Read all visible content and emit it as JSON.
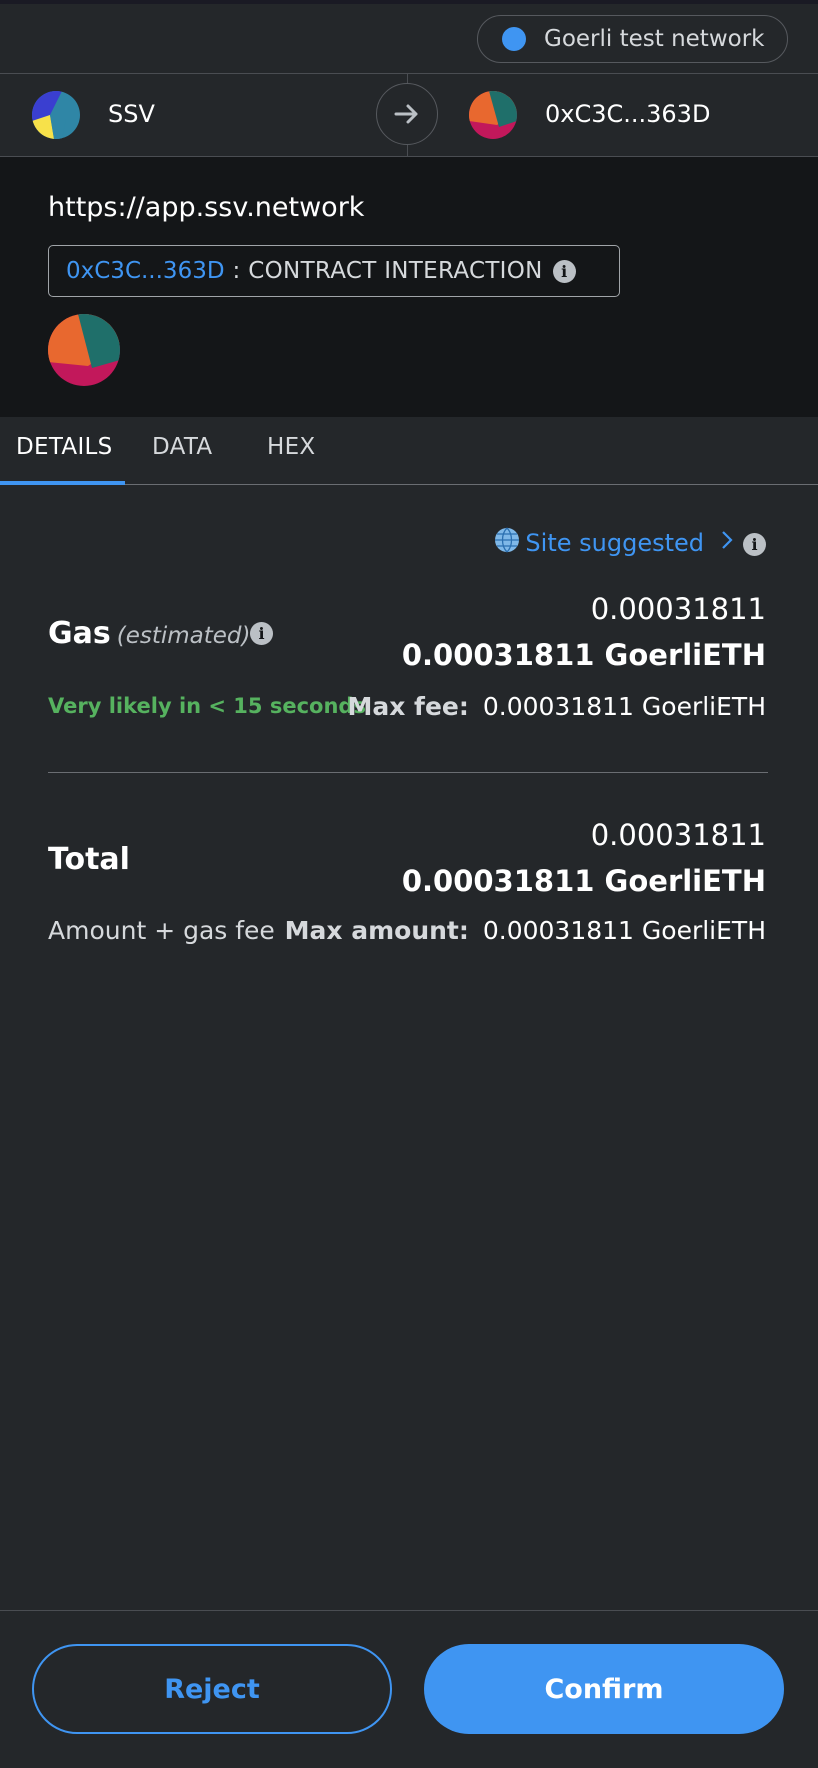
{
  "network": {
    "label": "Goerli test network",
    "dot_color": "#3f95f2"
  },
  "from_account": {
    "name": "SSV",
    "avatar_icon": "jazzicon-avatar"
  },
  "to_account": {
    "name": "0xC3C...363D",
    "avatar_icon": "jazzicon-avatar"
  },
  "origin": {
    "url": "https://app.ssv.network",
    "contract_address": "0xC3C...363D",
    "separator": ":",
    "interaction_type": "CONTRACT INTERACTION"
  },
  "tabs": [
    {
      "label": "DETAILS",
      "active": true
    },
    {
      "label": "DATA",
      "active": false
    },
    {
      "label": "HEX",
      "active": false
    }
  ],
  "site_suggested": {
    "label": "Site suggested",
    "icon": "globe-icon"
  },
  "gas": {
    "label": "Gas",
    "estimated_label": "(estimated)",
    "value": "0.00031811",
    "value_eth": "0.00031811 GoerliETH",
    "likely_text": "Very likely in < 15 seconds",
    "max_fee_label": "Max fee:",
    "max_fee_value": "0.00031811 GoerliETH"
  },
  "total": {
    "label": "Total",
    "value": "0.00031811",
    "value_eth": "0.00031811 GoerliETH",
    "subtitle": "Amount + gas fee",
    "max_amount_label": "Max amount:",
    "max_amount_value": "0.00031811 GoerliETH"
  },
  "footer": {
    "reject_label": "Reject",
    "confirm_label": "Confirm"
  },
  "colors": {
    "accent": "#3f95f2",
    "success": "#56b25f",
    "background": "#24272a",
    "panel": "#141618"
  }
}
